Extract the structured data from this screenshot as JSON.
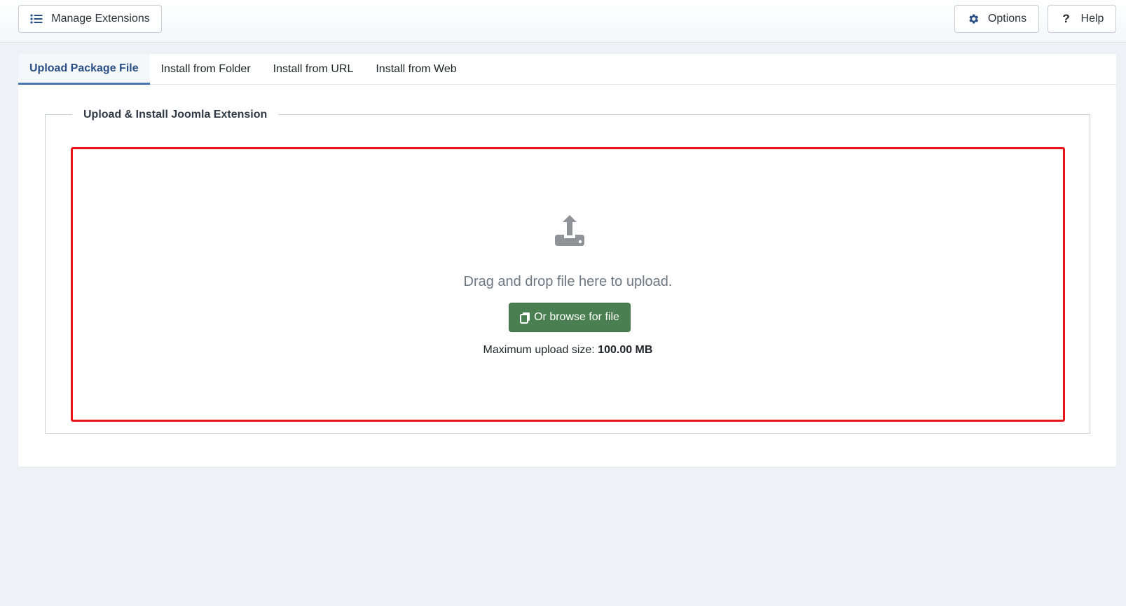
{
  "toolbar": {
    "manage_label": "Manage Extensions",
    "options_label": "Options",
    "help_label": "Help",
    "help_glyph": "?"
  },
  "tabs": [
    {
      "label": "Upload Package File",
      "active": true
    },
    {
      "label": "Install from Folder",
      "active": false
    },
    {
      "label": "Install from URL",
      "active": false
    },
    {
      "label": "Install from Web",
      "active": false
    }
  ],
  "upload": {
    "legend": "Upload & Install Joomla Extension",
    "drag_text": "Drag and drop file here to upload.",
    "browse_label": "Or browse for file",
    "max_label": "Maximum upload size:",
    "max_value": "100.00 MB"
  },
  "colors": {
    "accent": "#2a4f87",
    "browse_button": "#4a7f52",
    "dropzone_border": "#e8141a"
  },
  "icons": {
    "manage": "list-icon",
    "options": "gear-icon",
    "help": "question-icon",
    "upload": "upload-icon",
    "browse": "copy-icon"
  }
}
